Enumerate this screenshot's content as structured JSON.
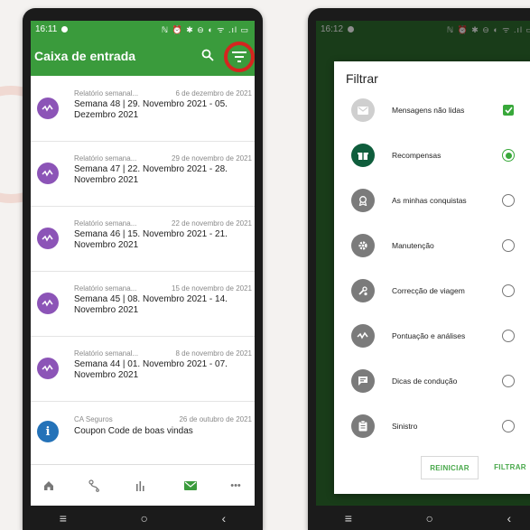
{
  "left": {
    "status": {
      "time": "16:11",
      "icons": "ℕ ⏰ ✱ ⊖ ◐ ᯤ .ıl ▭"
    },
    "appbar": {
      "title": "Caixa de entrada",
      "search_icon": "search-icon",
      "filter_icon": "filter-list-icon"
    },
    "inbox": [
      {
        "category": "Relatório semanal...",
        "date": "6 de dezembro de 2021",
        "title": "Semana 48 | 29. Novembro 2021 - 05. Dezembro 2021",
        "icon": "score-icon"
      },
      {
        "category": "Relatório semana...",
        "date": "29 de novembro de 2021",
        "title": "Semana 47 | 22. Novembro 2021 - 28. Novembro 2021",
        "icon": "score-icon"
      },
      {
        "category": "Relatório semana...",
        "date": "22 de novembro de 2021",
        "title": "Semana 46 | 15. Novembro 2021 - 21. Novembro 2021",
        "icon": "score-icon"
      },
      {
        "category": "Relatório semana...",
        "date": "15 de novembro de 2021",
        "title": "Semana 45 | 08. Novembro 2021 - 14. Novembro 2021",
        "icon": "score-icon"
      },
      {
        "category": "Relatório semanal...",
        "date": "8 de novembro de 2021",
        "title": "Semana 44 | 01. Novembro 2021 - 07. Novembro 2021",
        "icon": "score-icon"
      },
      {
        "category": "CA Seguros",
        "date": "26 de outubro de 2021",
        "title": "Coupon Code de boas vindas",
        "icon": "info-icon",
        "icon_text": "i"
      }
    ],
    "bottom_nav": [
      "home-icon",
      "trips-icon",
      "stats-icon",
      "mail-icon",
      "more-icon"
    ],
    "more_label": "•••",
    "sysnav": {
      "menu": "≡",
      "home": "○",
      "back": "‹"
    }
  },
  "right": {
    "status": {
      "time": "16:12",
      "icons": "ℕ ⏰ ✱ ⊖ ◐ ᯤ .ıl ▭"
    },
    "dialog": {
      "title": "Filtrar",
      "options": [
        {
          "label": "Mensagens não lidas",
          "icon": "mail-icon",
          "control": "checkbox",
          "checked": true
        },
        {
          "label": "Recompensas",
          "icon": "gift-icon",
          "control": "radio",
          "checked": true
        },
        {
          "label": "As minhas conquistas",
          "icon": "award-icon",
          "control": "radio",
          "checked": false
        },
        {
          "label": "Manutenção",
          "icon": "gear-icon",
          "control": "radio",
          "checked": false
        },
        {
          "label": "Correcção de viagem",
          "icon": "wrench-icon",
          "control": "radio",
          "checked": false
        },
        {
          "label": "Pontuação e análises",
          "icon": "score-icon",
          "control": "radio",
          "checked": false
        },
        {
          "label": "Dicas de condução",
          "icon": "chat-icon",
          "control": "radio",
          "checked": false
        },
        {
          "label": "Sinistro",
          "icon": "clipboard-icon",
          "control": "radio",
          "checked": false
        }
      ],
      "reset_label": "REINICIAR",
      "filter_label": "FILTRAR"
    },
    "sysnav": {
      "menu": "≡",
      "home": "○",
      "back": "‹"
    }
  },
  "colors": {
    "green": "#3a9b3c",
    "red_circle": "#d5251f",
    "purple": "#8c54b7",
    "blue": "#2472b8",
    "check_green": "#38a83a"
  }
}
